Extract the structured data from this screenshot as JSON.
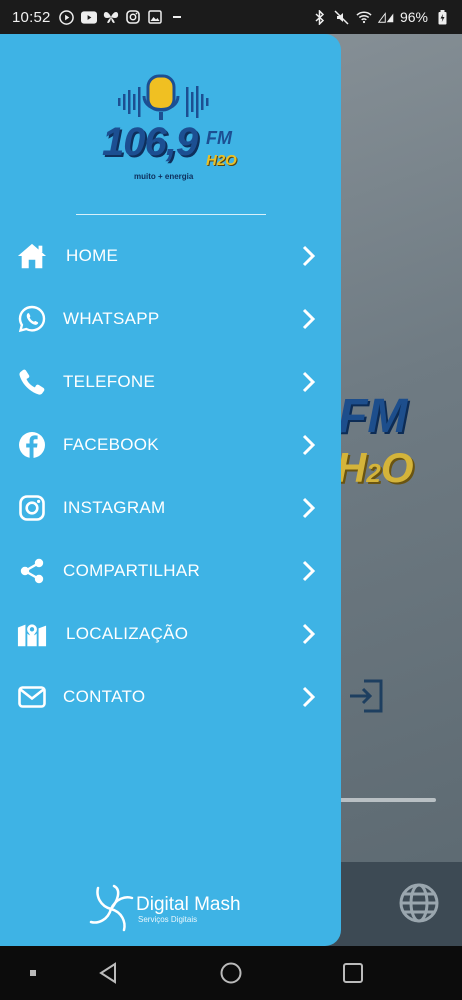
{
  "status_bar": {
    "time": "10:52",
    "battery": "96%",
    "left_icons": [
      "play-icon",
      "youtube-icon",
      "butterfly-icon",
      "instagram-icon",
      "image-icon",
      "minus-icon"
    ],
    "right_icons": [
      "bluetooth-icon",
      "mute-icon",
      "wifi-icon",
      "signal-icon",
      "battery-icon"
    ]
  },
  "logo": {
    "frequency": "106,9",
    "fm": "FM",
    "h2o": "H2O",
    "tagline": "muito + energia"
  },
  "menu": [
    {
      "label": "HOME",
      "icon": "home-icon"
    },
    {
      "label": "WHATSAPP",
      "icon": "whatsapp-icon"
    },
    {
      "label": "TELEFONE",
      "icon": "phone-icon"
    },
    {
      "label": "FACEBOOK",
      "icon": "facebook-icon"
    },
    {
      "label": "INSTAGRAM",
      "icon": "instagram-icon"
    },
    {
      "label": "COMPARTILHAR",
      "icon": "share-icon"
    },
    {
      "label": "LOCALIZAÇÃO",
      "icon": "map-icon"
    },
    {
      "label": "CONTATO",
      "icon": "envelope-icon"
    }
  ],
  "footer": {
    "brand_name": "Digital Mash",
    "brand_sub": "Serviços Digitais"
  },
  "background": {
    "fm": "FM",
    "h": "H",
    "two": "2",
    "o": "O"
  },
  "colors": {
    "drawer": "#3eb3e5",
    "text": "#ffffff",
    "status_bar": "#1b1b1b"
  }
}
